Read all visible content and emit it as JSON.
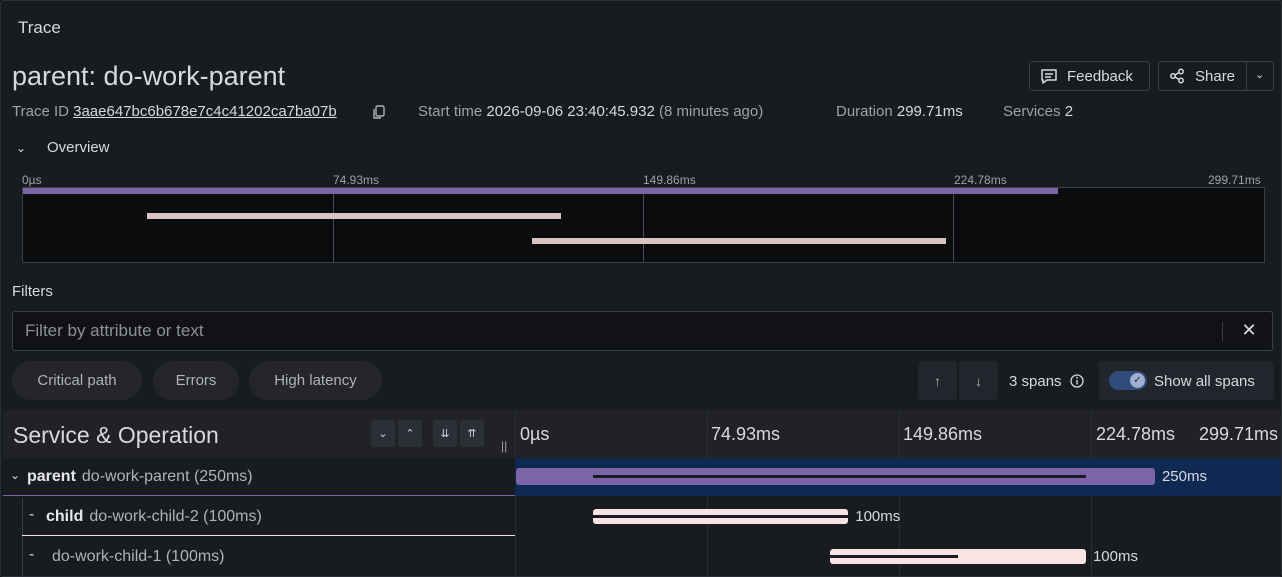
{
  "panel": {
    "title": "Trace"
  },
  "trace": {
    "title": "parent: do-work-parent",
    "trace_id_label": "Trace ID",
    "trace_id": "3aae647bc6b678e7c4c41202ca7ba07b",
    "start_label": "Start time",
    "start_time": "2026-09-06 23:40:45.932",
    "start_relative": "(8 minutes ago)",
    "duration_label": "Duration",
    "duration": "299.71ms",
    "services_label": "Services",
    "services": "2"
  },
  "actions": {
    "feedback": "Feedback",
    "share": "Share"
  },
  "overview": {
    "label": "Overview",
    "ticks": [
      "0µs",
      "74.93ms",
      "149.86ms",
      "224.78ms",
      "299.71ms"
    ]
  },
  "filters": {
    "label": "Filters",
    "placeholder": "Filter by attribute or text",
    "pills": [
      "Critical path",
      "Errors",
      "High latency"
    ],
    "spans_count": "3 spans",
    "show_all": "Show all spans"
  },
  "table": {
    "header": "Service & Operation",
    "ticks": [
      "0µs",
      "74.93ms",
      "149.86ms",
      "224.78ms",
      "299.71ms"
    ],
    "rows": [
      {
        "service": "parent",
        "operation": "do-work-parent (250ms)",
        "duration": "250ms"
      },
      {
        "service": "child",
        "operation": "do-work-child-2 (100ms)",
        "duration": "100ms"
      },
      {
        "service": "",
        "operation": "do-work-child-1 (100ms)",
        "duration": "100ms"
      }
    ]
  },
  "chart_data": {
    "type": "gantt",
    "x_unit": "ms",
    "xlim": [
      0,
      299.71
    ],
    "spans": [
      {
        "name": "do-work-parent",
        "start": 0,
        "duration": 250,
        "color": "#7b64a8"
      },
      {
        "name": "do-work-child-2",
        "start": 30,
        "duration": 100,
        "color": "#f8e5e3"
      },
      {
        "name": "do-work-child-1",
        "start": 123,
        "duration": 100,
        "color": "#f8e5e3"
      }
    ]
  },
  "colors": {
    "parent_row_bg": "#0e2a52",
    "parent_bar": "#7b64a8",
    "child_bar": "#f8e5e3",
    "minimap_child": "#d9c4c4"
  }
}
